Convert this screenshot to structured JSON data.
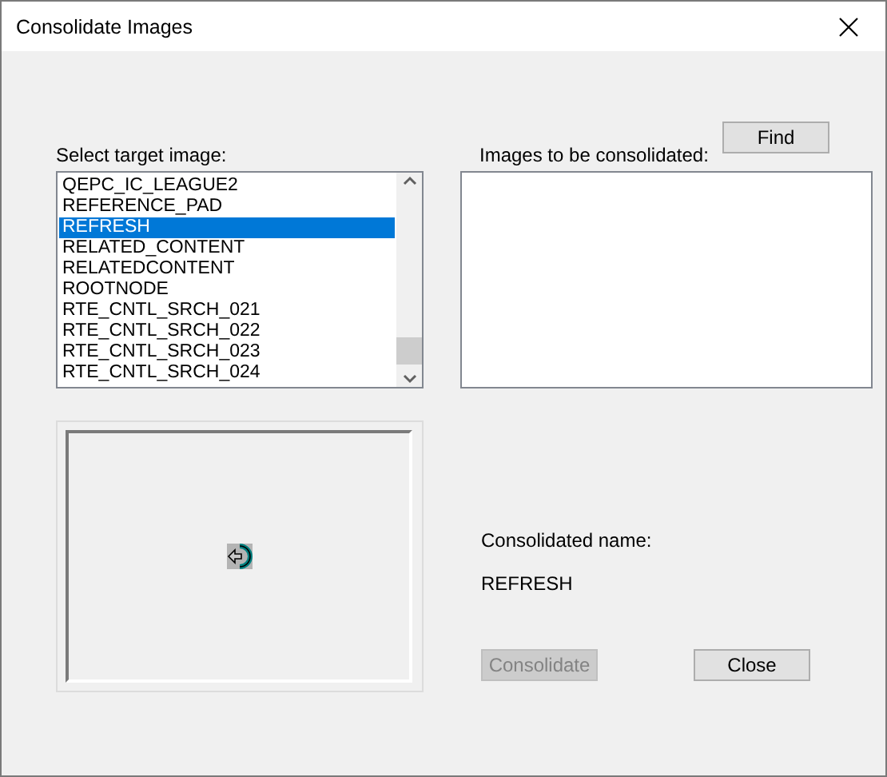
{
  "window": {
    "title": "Consolidate Images"
  },
  "target": {
    "label": "Select target image:",
    "items": [
      {
        "text": "QEPC_IC_LEAGUE2",
        "selected": false
      },
      {
        "text": "REFERENCE_PAD",
        "selected": false
      },
      {
        "text": "REFRESH",
        "selected": true
      },
      {
        "text": "RELATED_CONTENT",
        "selected": false
      },
      {
        "text": "RELATEDCONTENT",
        "selected": false
      },
      {
        "text": "ROOTNODE",
        "selected": false
      },
      {
        "text": "RTE_CNTL_SRCH_021",
        "selected": false
      },
      {
        "text": "RTE_CNTL_SRCH_022",
        "selected": false
      },
      {
        "text": "RTE_CNTL_SRCH_023",
        "selected": false
      },
      {
        "text": "RTE_CNTL_SRCH_024",
        "selected": false
      }
    ]
  },
  "images": {
    "label": "Images to be consolidated:",
    "find_button": "Find"
  },
  "consolidated": {
    "label": "Consolidated name:",
    "value": "REFRESH"
  },
  "buttons": [
    {
      "label": "Consolidate",
      "disabled": true
    },
    {
      "label": "Close",
      "disabled": false
    }
  ]
}
